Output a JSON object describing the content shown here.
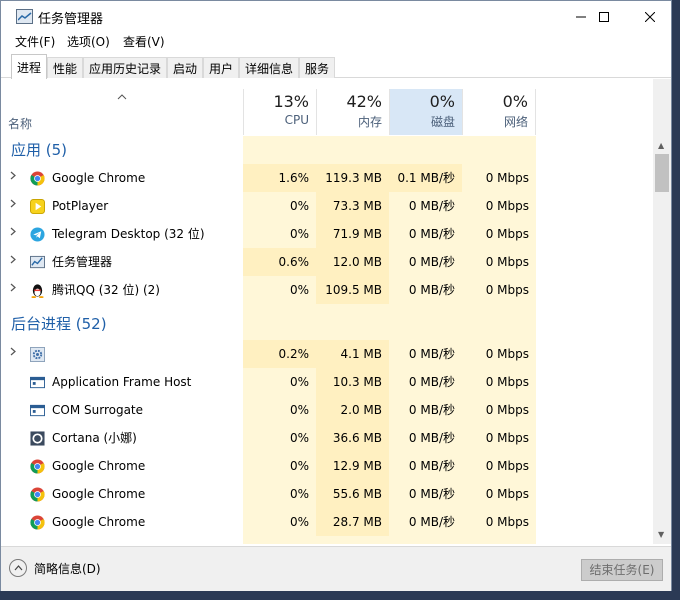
{
  "window": {
    "title": "任务管理器"
  },
  "menu": [
    "文件(F)",
    "选项(O)",
    "查看(V)"
  ],
  "tabs": [
    "进程",
    "性能",
    "应用历史记录",
    "启动",
    "用户",
    "详细信息",
    "服务"
  ],
  "columns": {
    "name": "名称",
    "cpu": {
      "pct": "13%",
      "label": "CPU"
    },
    "mem": {
      "pct": "42%",
      "label": "内存"
    },
    "disk": {
      "pct": "0%",
      "label": "磁盘"
    },
    "net": {
      "pct": "0%",
      "label": "网络"
    }
  },
  "groups": {
    "apps": "应用 (5)",
    "background": "后台进程 (52)"
  },
  "apps": [
    {
      "name": "Google Chrome",
      "icon": "chrome-icon",
      "cpu": "1.6%",
      "mem": "119.3 MB",
      "disk": "0.1 MB/秒",
      "net": "0 Mbps"
    },
    {
      "name": "PotPlayer",
      "icon": "potplayer-icon",
      "cpu": "0%",
      "mem": "73.3 MB",
      "disk": "0 MB/秒",
      "net": "0 Mbps"
    },
    {
      "name": "Telegram Desktop (32 位)",
      "icon": "telegram-icon",
      "cpu": "0%",
      "mem": "71.9 MB",
      "disk": "0 MB/秒",
      "net": "0 Mbps"
    },
    {
      "name": "任务管理器",
      "icon": "task-manager-icon",
      "cpu": "0.6%",
      "mem": "12.0 MB",
      "disk": "0 MB/秒",
      "net": "0 Mbps"
    },
    {
      "name": "腾讯QQ (32 位) (2)",
      "icon": "qq-penguin-icon",
      "cpu": "0%",
      "mem": "109.5 MB",
      "disk": "0 MB/秒",
      "net": "0 Mbps"
    }
  ],
  "background": [
    {
      "name": "",
      "icon": "gear-icon",
      "cpu": "0.2%",
      "mem": "4.1 MB",
      "disk": "0 MB/秒",
      "net": "0 Mbps"
    },
    {
      "name": "Application Frame Host",
      "icon": "app-frame-icon",
      "cpu": "0%",
      "mem": "10.3 MB",
      "disk": "0 MB/秒",
      "net": "0 Mbps"
    },
    {
      "name": "COM Surrogate",
      "icon": "app-frame-icon",
      "cpu": "0%",
      "mem": "2.0 MB",
      "disk": "0 MB/秒",
      "net": "0 Mbps"
    },
    {
      "name": "Cortana (小娜)",
      "icon": "cortana-icon",
      "cpu": "0%",
      "mem": "36.6 MB",
      "disk": "0 MB/秒",
      "net": "0 Mbps"
    },
    {
      "name": "Google Chrome",
      "icon": "chrome-icon",
      "cpu": "0%",
      "mem": "12.9 MB",
      "disk": "0 MB/秒",
      "net": "0 Mbps"
    },
    {
      "name": "Google Chrome",
      "icon": "chrome-icon",
      "cpu": "0%",
      "mem": "55.6 MB",
      "disk": "0 MB/秒",
      "net": "0 Mbps"
    },
    {
      "name": "Google Chrome",
      "icon": "chrome-icon",
      "cpu": "0%",
      "mem": "28.7 MB",
      "disk": "0 MB/秒",
      "net": "0 Mbps"
    }
  ],
  "footer": {
    "fewer_details": "简略信息(D)",
    "end_task": "结束任务(E)"
  },
  "colors": {
    "group_title": "#1f5fa8",
    "column_bg": "#fff7d8",
    "cell_fill": "#fff0c1",
    "disk_header_hl": "#d8e7f6"
  }
}
